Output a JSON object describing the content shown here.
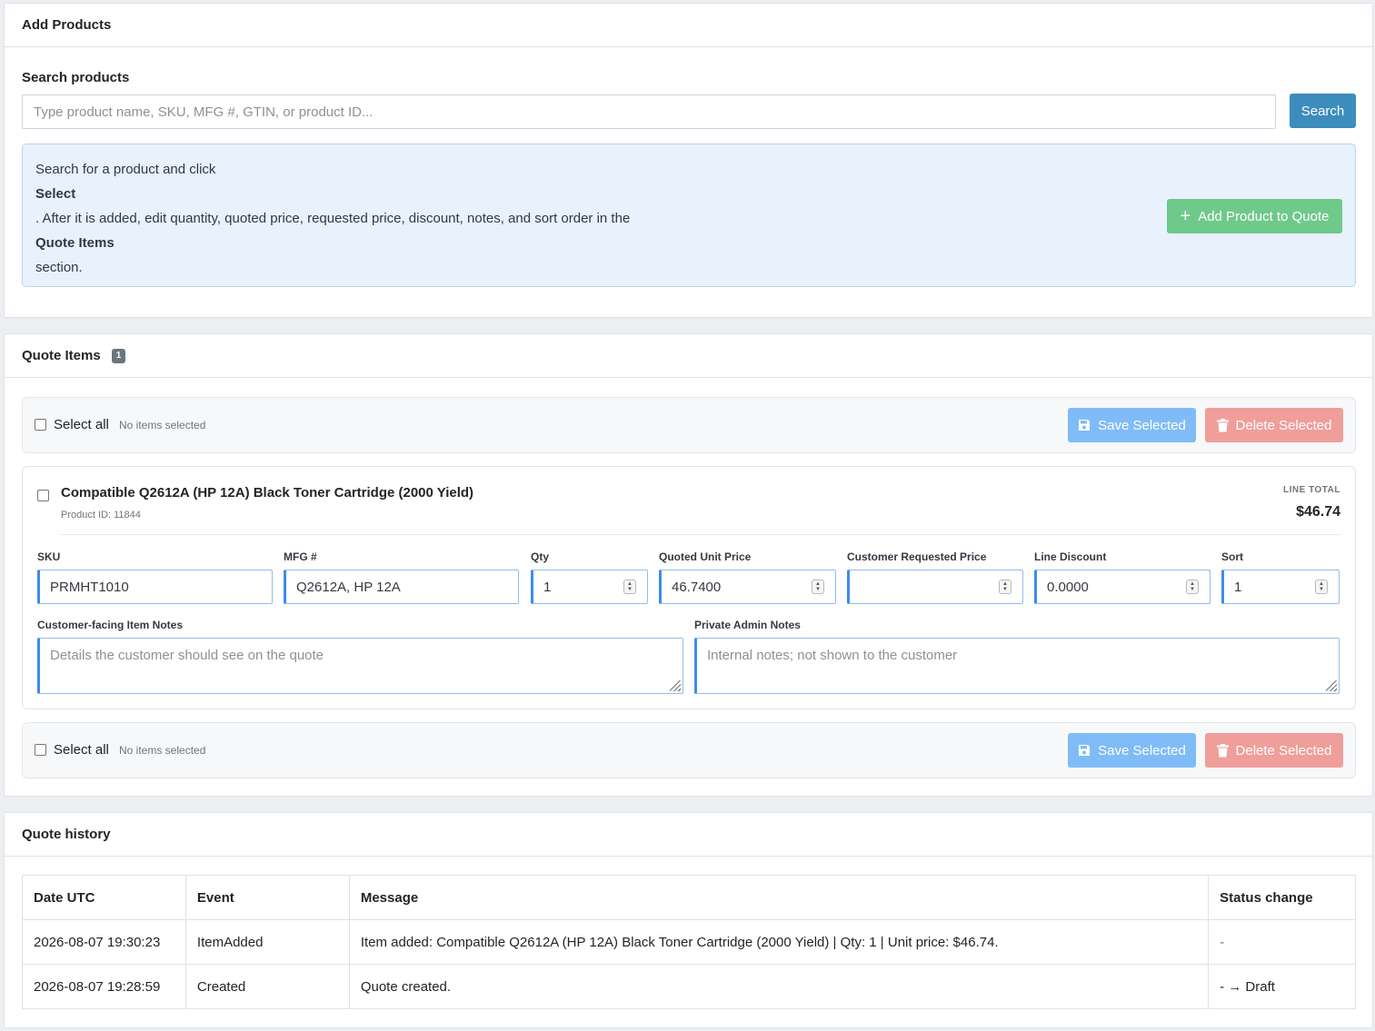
{
  "add_products": {
    "title": "Add Products",
    "search_label": "Search products",
    "search_placeholder": "Type product name, SKU, MFG #, GTIN, or product ID...",
    "search_button": "Search",
    "info_line1": "Search for a product and click",
    "info_bold1": "Select",
    "info_line2": ". After it is added, edit quantity, quoted price, requested price, discount, notes, and sort order in the",
    "info_bold2": "Quote Items",
    "info_line3": "section.",
    "add_button": "Add Product to Quote"
  },
  "quote_items": {
    "title": "Quote Items",
    "count": "1",
    "bulk": {
      "select_all": "Select all",
      "status": "No items selected",
      "save": "Save Selected",
      "delete": "Delete Selected"
    },
    "item": {
      "name": "Compatible Q2612A (HP 12A) Black Toner Cartridge (2000 Yield)",
      "product_id": "Product ID: 11844",
      "line_total_label": "LINE TOTAL",
      "line_total": "$46.74",
      "fields": {
        "sku_label": "SKU",
        "sku": "PRMHT1010",
        "mfg_label": "MFG #",
        "mfg": "Q2612A, HP 12A",
        "qty_label": "Qty",
        "qty": "1",
        "quoted_label": "Quoted Unit Price",
        "quoted": "46.7400",
        "requested_label": "Customer Requested Price",
        "requested": "",
        "discount_label": "Line Discount",
        "discount": "0.0000",
        "sort_label": "Sort",
        "sort": "1"
      },
      "customer_notes_label": "Customer-facing Item Notes",
      "customer_notes_placeholder": "Details the customer should see on the quote",
      "admin_notes_label": "Private Admin Notes",
      "admin_notes_placeholder": "Internal notes; not shown to the customer"
    }
  },
  "history": {
    "title": "Quote history",
    "columns": [
      "Date UTC",
      "Event",
      "Message",
      "Status change"
    ],
    "rows": [
      [
        "2026-08-07 19:30:23",
        "ItemAdded",
        "Item added: Compatible Q2612A (HP 12A) Black Toner Cartridge (2000 Yield) | Qty: 1 | Unit price: $46.74.",
        "-"
      ],
      [
        "2026-08-07 19:28:59",
        "Created",
        "Quote created.",
        "- → Draft"
      ]
    ]
  }
}
